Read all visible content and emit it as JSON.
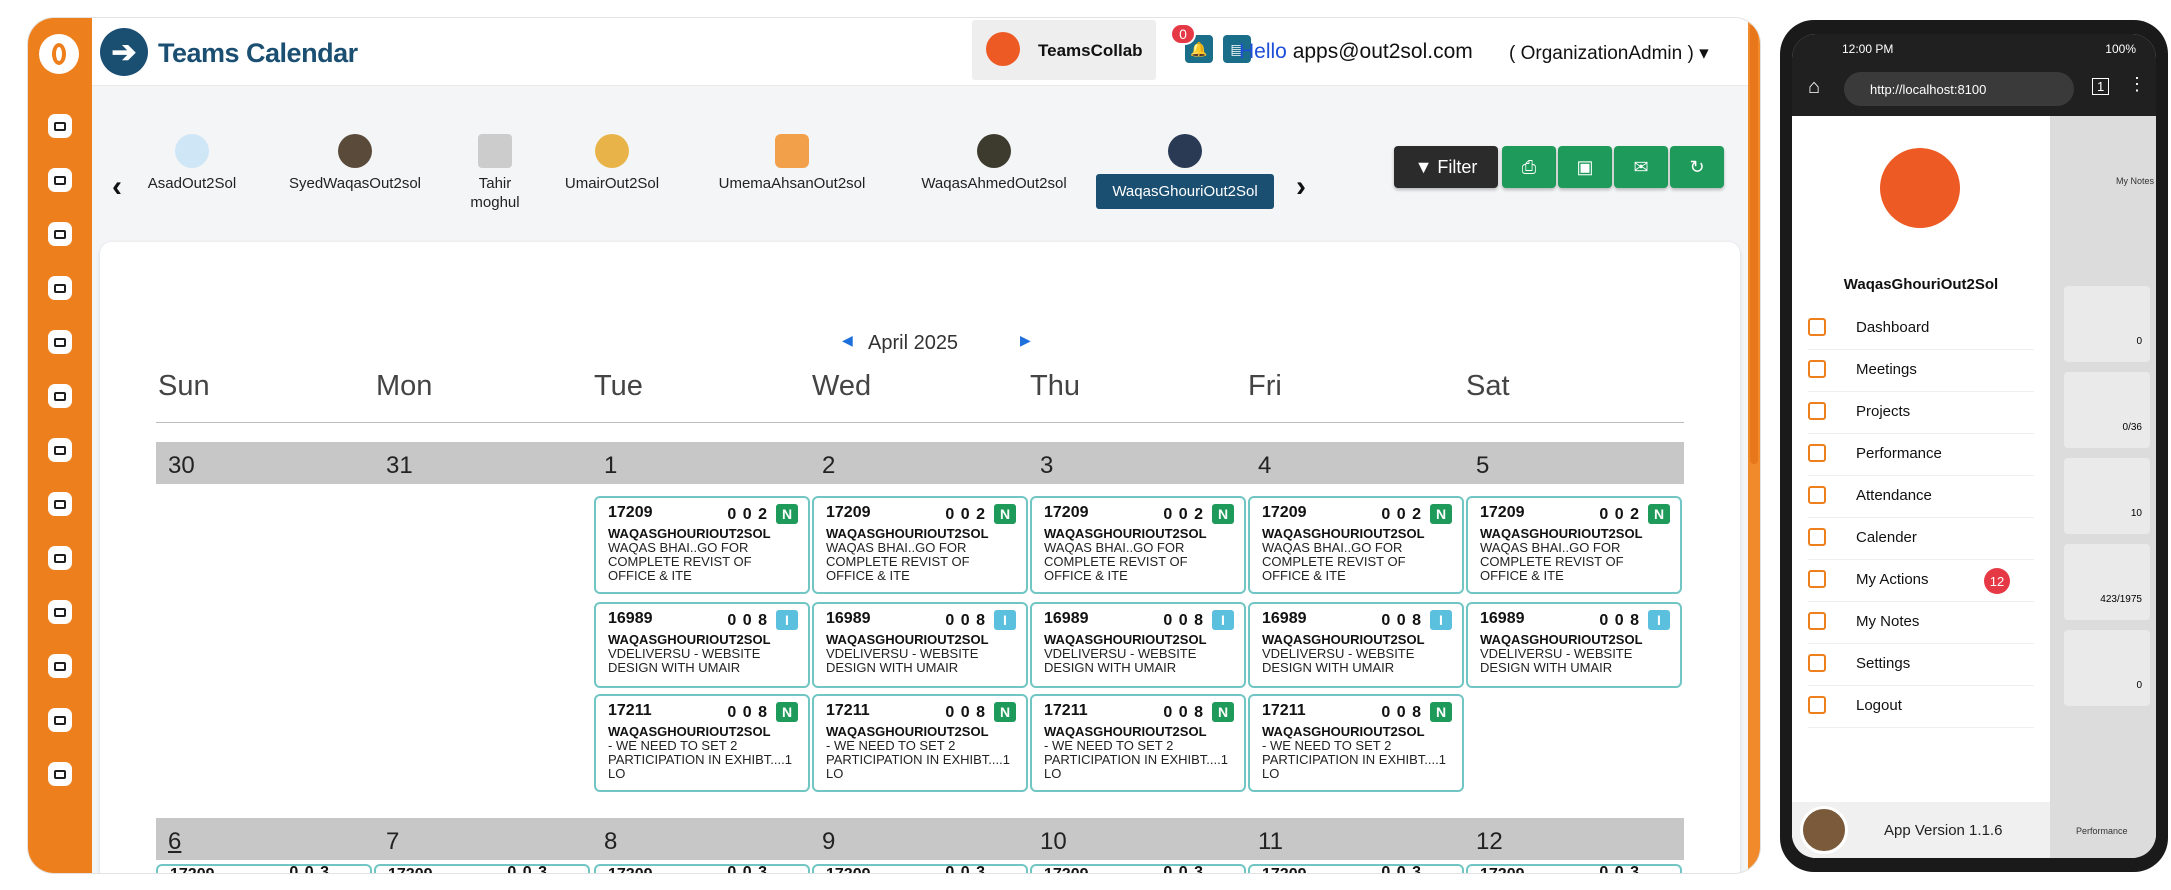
{
  "app": {
    "title": "Teams Calendar"
  },
  "header": {
    "org_name": "TeamsCollab",
    "notification_count": "0",
    "hello_prefix": "Hello",
    "email": "apps@out2sol.com",
    "role": "( OrganizationAdmin )"
  },
  "users": [
    {
      "name": "AsadOut2Sol",
      "selected": false
    },
    {
      "name": "SyedWaqasOut2sol",
      "selected": false
    },
    {
      "name": "Tahir moghul",
      "selected": false
    },
    {
      "name": "UmairOut2Sol",
      "selected": false
    },
    {
      "name": "UmemaAhsanOut2sol",
      "selected": false
    },
    {
      "name": "WaqasAhmedOut2sol",
      "selected": false
    },
    {
      "name": "WaqasGhouriOut2Sol",
      "selected": true
    }
  ],
  "toolbar": {
    "filter_label": "Filter",
    "buttons": [
      "print",
      "excel",
      "email",
      "refresh"
    ],
    "accent": "#1e9a5a",
    "filter_bg": "#2b2b2b"
  },
  "calendar": {
    "month_label": "April 2025",
    "weekdays": [
      "Sun",
      "Mon",
      "Tue",
      "Wed",
      "Thu",
      "Fri",
      "Sat"
    ],
    "week1_days": [
      "30",
      "31",
      "1",
      "2",
      "3",
      "4",
      "5"
    ],
    "week2_days": [
      "6",
      "7",
      "8",
      "9",
      "10",
      "11",
      "12"
    ],
    "event_types": [
      {
        "id": "17209",
        "counts": "0 0 2",
        "status": "N",
        "status_color": "#1e9a5a",
        "owner": "WAQASGHOURIOUT2SOL",
        "desc": "WAQAS BHAI..GO FOR COMPLETE REVIST OF OFFICE & ITE"
      },
      {
        "id": "16989",
        "counts": "0 0 8",
        "status": "I",
        "status_color": "#5bc0de",
        "owner": "WAQASGHOURIOUT2SOL",
        "desc": "VDELIVERSU - WEBSITE DESIGN WITH UMAIR"
      },
      {
        "id": "17211",
        "counts": "0 0 8",
        "status": "N",
        "status_color": "#1e9a5a",
        "owner": "WAQASGHOURIOUT2SOL",
        "desc": "- WE NEED TO SET 2 PARTICIPATION IN EXHIBT....1 LO"
      }
    ],
    "week2_partial_id": "17209",
    "week2_partial_counts": "0 0 3"
  },
  "phone": {
    "time": "12:00 PM",
    "battery": "100%",
    "url": "http://localhost:8100",
    "username": "WaqasGhouriOut2Sol",
    "menu": [
      {
        "label": "Dashboard"
      },
      {
        "label": "Meetings"
      },
      {
        "label": "Projects"
      },
      {
        "label": "Performance"
      },
      {
        "label": "Attendance"
      },
      {
        "label": "Calender"
      },
      {
        "label": "My Actions",
        "badge": "12"
      },
      {
        "label": "My Notes"
      },
      {
        "label": "Settings"
      },
      {
        "label": "Logout"
      }
    ],
    "version": "App Version 1.1.6",
    "behind": {
      "my_notes": "My Notes",
      "vals": [
        "0",
        "0/36",
        "10",
        "423/1975",
        "0"
      ],
      "performance": "Performance"
    }
  }
}
